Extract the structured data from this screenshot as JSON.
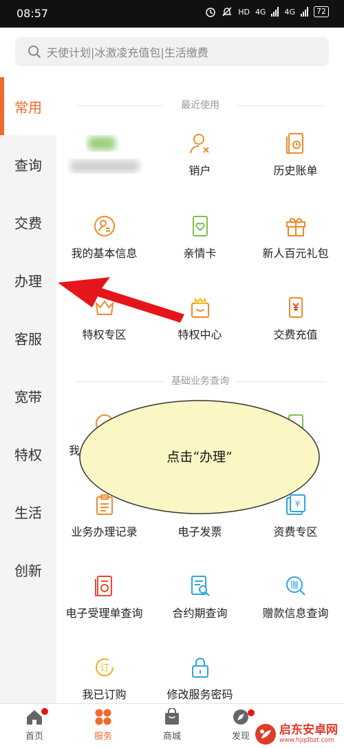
{
  "status_bar": {
    "time": "08:57",
    "network_1": "4G",
    "network_2": "4G",
    "hd": "HD",
    "battery": "72"
  },
  "search": {
    "placeholder": "天使计划|冰激凌充值包|生活缴费"
  },
  "sidebar": {
    "items": [
      "常用",
      "查询",
      "交费",
      "办理",
      "客服",
      "宽带",
      "特权",
      "生活",
      "创新"
    ],
    "active": "常用"
  },
  "sections": {
    "recent": "最近使用",
    "basic": "基础业务查询"
  },
  "tiles": {
    "cancel_account": "销户",
    "history_bill": "历史账单",
    "basic_info": "我的基本信息",
    "family_card": "亲情卡",
    "new_gift": "新人百元礼包",
    "privilege_zone": "特权专区",
    "privilege_center": "特权中心",
    "recharge": "交费充值",
    "partial_label": "我",
    "business_record": "业务办理记录",
    "e_invoice": "电子发票",
    "tariff_zone": "资费专区",
    "e_receipt": "电子受理单查询",
    "contract_query": "合约期查询",
    "gift_query": "赠款信息查询",
    "my_orders": "我已订购",
    "change_password": "修改服务密码"
  },
  "annotation": {
    "text": "点击“办理”"
  },
  "tabbar": {
    "home": "首页",
    "service": "服务",
    "mall": "商城",
    "discover": "发现"
  },
  "watermark": {
    "main": "启东安卓网",
    "sub": "www.hjqdbzt.com"
  },
  "colors": {
    "accent": "#f06a2b",
    "badge": "#e81515",
    "icon_orange": "#f08a28",
    "icon_green": "#7cc04a",
    "icon_blue": "#2aa6e0",
    "bubble_fill": "#fbf7c4",
    "arrow": "#e5161b"
  }
}
